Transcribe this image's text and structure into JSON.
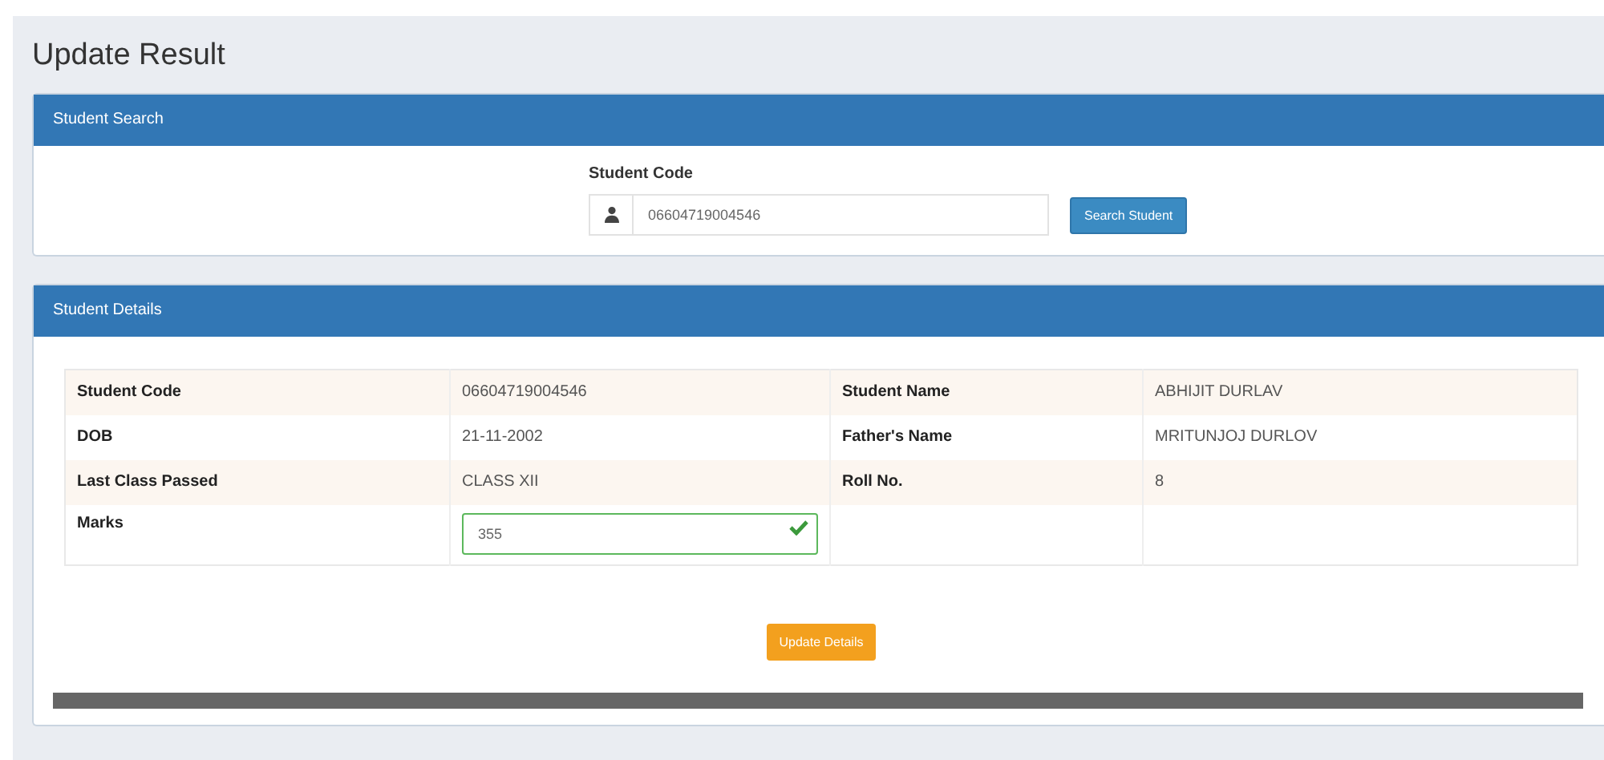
{
  "page_title": "Update Result",
  "search_panel": {
    "heading": "Student Search",
    "label": "Student Code",
    "field_value": "06604719004546",
    "button": "Search Student"
  },
  "details_panel": {
    "heading": "Student Details",
    "rows": [
      {
        "label": "Student Code",
        "value": "06604719004546",
        "label_2": "Student Name",
        "value_2": "ABHIJIT DURLAV"
      },
      {
        "label": "DOB",
        "value": "21-11-2002",
        "label_2": "Father's Name",
        "value_2": "MRITUNJOJ DURLOV"
      },
      {
        "label": "Last Class Passed",
        "value": "CLASS XII",
        "label_2": "Roll No.",
        "value_2": "8"
      }
    ],
    "marks": {
      "label": "Marks",
      "value": "355",
      "valid": true
    },
    "button": "Update Details"
  }
}
